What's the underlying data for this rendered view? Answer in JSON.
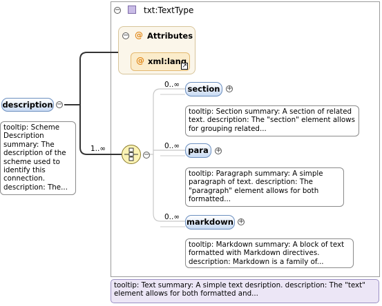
{
  "root": {
    "label": "description",
    "tooltip": "tooltip: Scheme Description summary: The description of the scheme used to identify this connection. description: The..."
  },
  "connector_cardinality": "1..∞",
  "type": {
    "name": "txt:TextType",
    "tooltip": "tooltip: Text summary: A simple text desription. description: The \"text\" element allows for both formatted and..."
  },
  "attributes": {
    "title": "Attributes",
    "items": [
      {
        "label": "xml:lang"
      }
    ]
  },
  "children": [
    {
      "cardinality": "0..∞",
      "label": "section",
      "tooltip": "tooltip: Section summary: A section of related text. description: The \"section\" element allows for grouping related..."
    },
    {
      "cardinality": "0..∞",
      "label": "para",
      "tooltip": "tooltip: Paragraph summary: A simple paragraph of text. description: The \"paragraph\" element allows for both formatted..."
    },
    {
      "cardinality": "0..∞",
      "label": "markdown",
      "tooltip": "tooltip: Markdown summary: A block of text formatted with Markdown directives. description: Markdown is a family of..."
    }
  ],
  "icons": {
    "collapse": "minus-circle-icon",
    "expand": "plus-circle-icon",
    "attribute": "at-sign-icon",
    "link": "arrow-link-icon",
    "sequence": "sequence-compositor-icon",
    "type": "complex-type-icon"
  },
  "colors": {
    "element_fill": "#c8daf3",
    "element_border": "#6a8ebf",
    "attribute_fill": "#fbeccb",
    "type_tooltip_fill": "#ece6f6"
  }
}
